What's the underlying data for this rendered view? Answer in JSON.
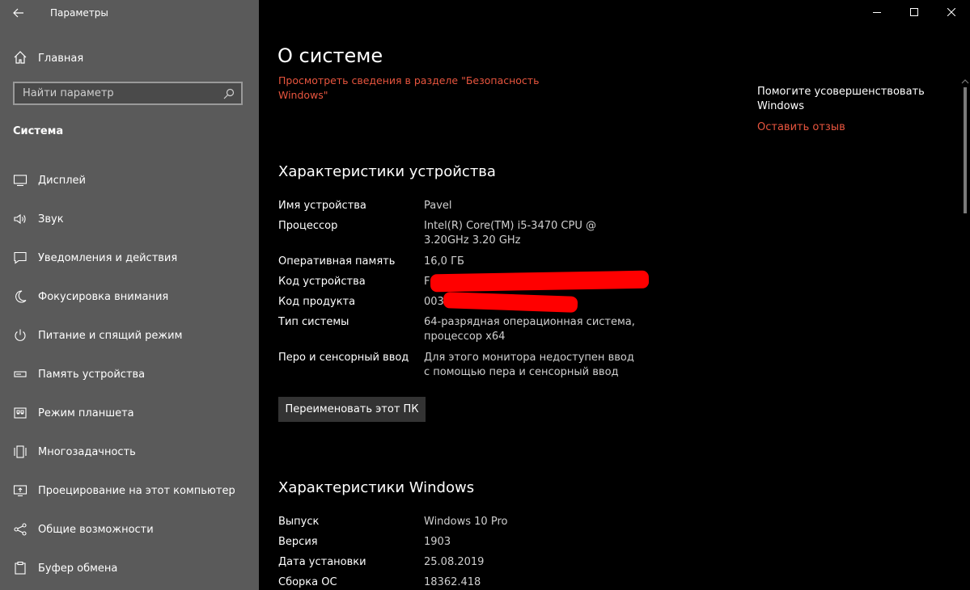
{
  "app": {
    "title": "Параметры"
  },
  "sidebar": {
    "home_label": "Главная",
    "search_placeholder": "Найти параметр",
    "section_title": "Система",
    "items": [
      {
        "label": "Дисплей",
        "icon": "display-icon"
      },
      {
        "label": "Звук",
        "icon": "sound-icon"
      },
      {
        "label": "Уведомления и действия",
        "icon": "notifications-icon"
      },
      {
        "label": "Фокусировка внимания",
        "icon": "focus-assist-icon"
      },
      {
        "label": "Питание и спящий режим",
        "icon": "power-icon"
      },
      {
        "label": "Память устройства",
        "icon": "storage-icon"
      },
      {
        "label": "Режим планшета",
        "icon": "tablet-mode-icon"
      },
      {
        "label": "Многозадачность",
        "icon": "multitasking-icon"
      },
      {
        "label": "Проецирование на этот компьютер",
        "icon": "projecting-icon"
      },
      {
        "label": "Общие возможности",
        "icon": "shared-experiences-icon"
      },
      {
        "label": "Буфер обмена",
        "icon": "clipboard-icon"
      }
    ]
  },
  "main": {
    "title": "О системе",
    "security_link": "Просмотреть сведения в разделе \"Безопасность Windows\"",
    "help": {
      "title": "Помогите усовершенствовать Windows",
      "feedback_link": "Оставить отзыв"
    },
    "device_specs": {
      "heading": "Характеристики устройства",
      "rows": [
        {
          "key": "Имя устройства",
          "value": "Pavel"
        },
        {
          "key": "Процессор",
          "value": "Intel(R) Core(TM) i5-3470 CPU @ 3.20GHz 3.20 GHz"
        },
        {
          "key": "Оперативная память",
          "value": "16,0 ГБ"
        },
        {
          "key": "Код устройства",
          "value": "F"
        },
        {
          "key": "Код продукта",
          "value": "003"
        },
        {
          "key": "Тип системы",
          "value": "64-разрядная операционная система, процессор x64"
        },
        {
          "key": "Перо и сенсорный ввод",
          "value": "Для этого монитора недоступен ввод с помощью пера и сенсорный ввод"
        }
      ],
      "rename_button": "Переименовать этот ПК"
    },
    "windows_specs": {
      "heading": "Характеристики Windows",
      "rows": [
        {
          "key": "Выпуск",
          "value": "Windows 10 Pro"
        },
        {
          "key": "Версия",
          "value": "1903"
        },
        {
          "key": "Дата установки",
          "value": "25.08.2019"
        },
        {
          "key": "Сборка ОС",
          "value": "18362.418"
        }
      ]
    }
  },
  "colors": {
    "accent": "#e8553e",
    "sidebar_bg": "#5a5a5a",
    "main_bg": "#000000",
    "redaction": "#ff0000"
  }
}
